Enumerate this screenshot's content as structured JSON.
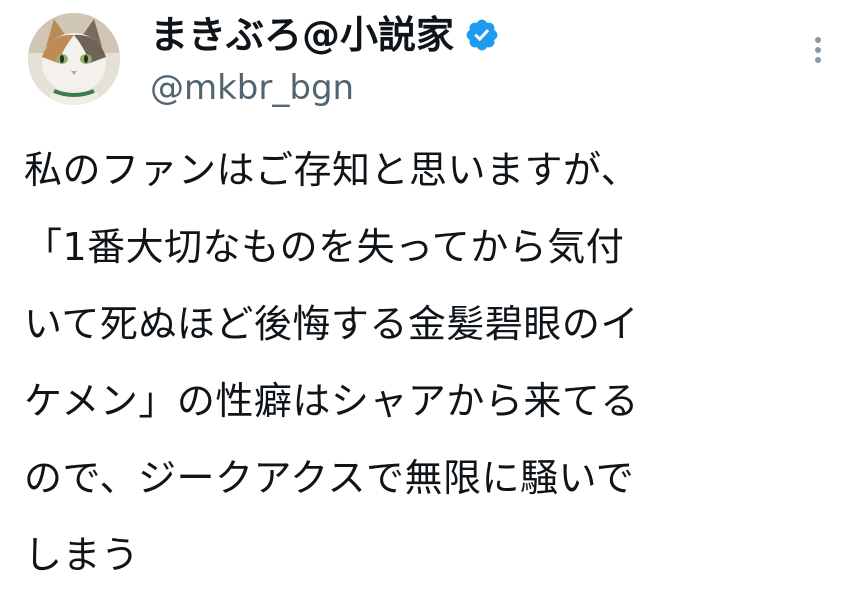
{
  "author": {
    "display_name": "まきぶろ@小説家",
    "handle": "@mkbr_bgn",
    "verified": true,
    "avatar_icon": "cat-avatar",
    "verified_color": "#1d9bf0"
  },
  "menu": {
    "icon": "more-vertical-icon"
  },
  "tweet": {
    "lines": [
      "私のファンはご存知と思いますが、",
      "「1番大切なものを失ってから気付",
      "いて死ぬほど後悔する金髪碧眼のイ",
      "ケメン」の性癖はシャアから来てる",
      "ので、ジークアクスで無限に騒いで",
      "しまう"
    ]
  }
}
